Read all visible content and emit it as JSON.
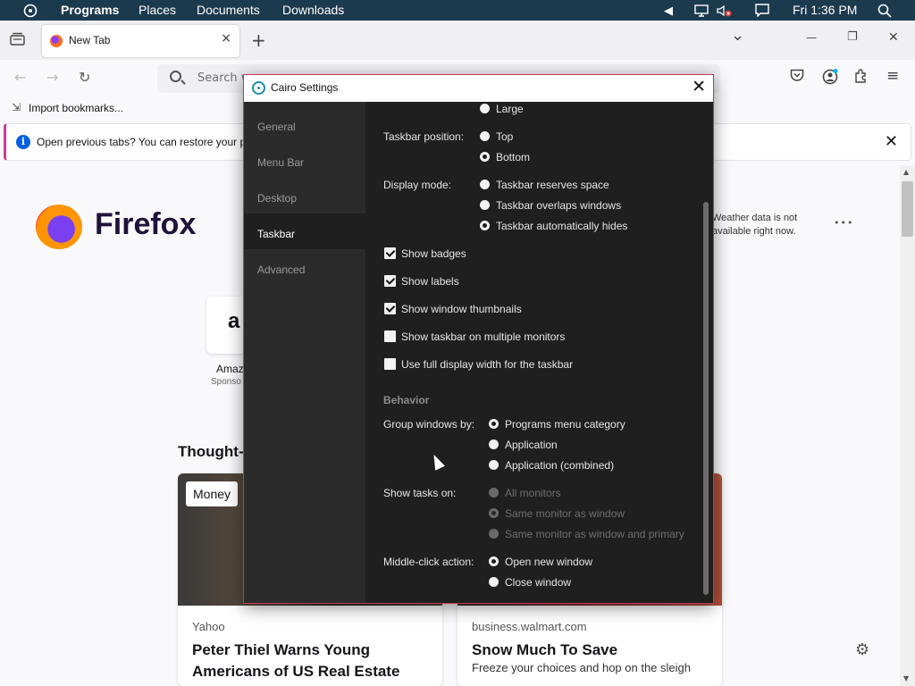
{
  "topbar": {
    "menus": [
      "Programs",
      "Places",
      "Documents",
      "Downloads"
    ],
    "clock": "Fri 1:36 PM",
    "icons": [
      "cairo-logo-icon",
      "tray-arrow-icon",
      "monitor-icon",
      "volume-muted-icon",
      "action-center-icon",
      "search-icon"
    ]
  },
  "browser": {
    "tab_title": "New Tab",
    "tab_close": "×",
    "new_tab": "+",
    "list_tabs": "⌄",
    "win_min": "—",
    "win_restore": "❐",
    "win_close": "✕",
    "search_placeholder": "Search w",
    "bookmark_import": "Import bookmarks...",
    "notification": "Open previous tabs? You can restore your pr",
    "notif_close": "✕"
  },
  "newtab": {
    "brand": "Firefox",
    "weather": "Weather data is not available right now.",
    "weather_more": "•••",
    "shortcut_label": "Amaz",
    "shortcut_sub": "Sponso",
    "section_title": "Thought-",
    "cards": [
      {
        "badge": "Money",
        "source": "Yahoo",
        "title": "Peter Thiel Warns Young Americans of US Real Estate"
      },
      {
        "source": "business.walmart.com",
        "title": "Snow Much To Save",
        "desc": "Freeze your choices and hop on the sleigh"
      }
    ]
  },
  "dialog": {
    "title": "Cairo Settings",
    "close": "✕",
    "sidebar": [
      "General",
      "Menu Bar",
      "Desktop",
      "Taskbar",
      "Advanced"
    ],
    "active_index": 3,
    "partial_top": "Large",
    "taskbar_position": {
      "label": "Taskbar position:",
      "options": [
        "Top",
        "Bottom"
      ],
      "selected": 1
    },
    "display_mode": {
      "label": "Display mode:",
      "options": [
        "Taskbar reserves space",
        "Taskbar overlaps windows",
        "Taskbar automatically hides"
      ],
      "selected": 2
    },
    "checkboxes": [
      {
        "label": "Show badges",
        "checked": true
      },
      {
        "label": "Show labels",
        "checked": true
      },
      {
        "label": "Show window thumbnails",
        "checked": true
      },
      {
        "label": "Show taskbar on multiple monitors",
        "checked": false
      },
      {
        "label": "Use full display width for the taskbar",
        "checked": false
      }
    ],
    "behavior_header": "Behavior",
    "group_by": {
      "label": "Group windows by:",
      "options": [
        "Programs menu category",
        "Application",
        "Application (combined)"
      ],
      "selected": 0
    },
    "show_tasks": {
      "label": "Show tasks on:",
      "options": [
        "All monitors",
        "Same monitor as window",
        "Same monitor as window and primary"
      ],
      "selected": 1,
      "disabled": true
    },
    "middle_click": {
      "label": "Middle-click action:",
      "options": [
        "Open new window",
        "Close window"
      ],
      "selected": 0
    }
  }
}
